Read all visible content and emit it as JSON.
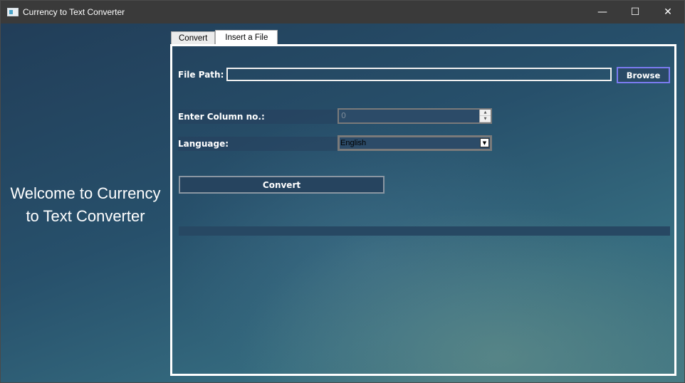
{
  "window": {
    "title": "Currency to Text Converter",
    "controls": {
      "minimize": "—",
      "maximize": "☐",
      "close": "✕"
    }
  },
  "welcome": {
    "line1": "Welcome to Currency",
    "line2": "to Text Converter"
  },
  "tabs": [
    {
      "label": "Convert",
      "active": false
    },
    {
      "label": "Insert a File",
      "active": true
    }
  ],
  "form": {
    "file_path_label": "File Path:",
    "file_path_value": "",
    "browse_label": "Browse",
    "column_label": "Enter Column no.:",
    "column_value": "0",
    "language_label": "Language:",
    "language_value": "English",
    "convert_label": "Convert",
    "progress": 0
  },
  "icons": {
    "spin_up": "▲",
    "spin_down": "▼",
    "dropdown": "▼"
  },
  "colors": {
    "browse_border": "#7b7bf0",
    "panel_border": "#ffffff"
  }
}
